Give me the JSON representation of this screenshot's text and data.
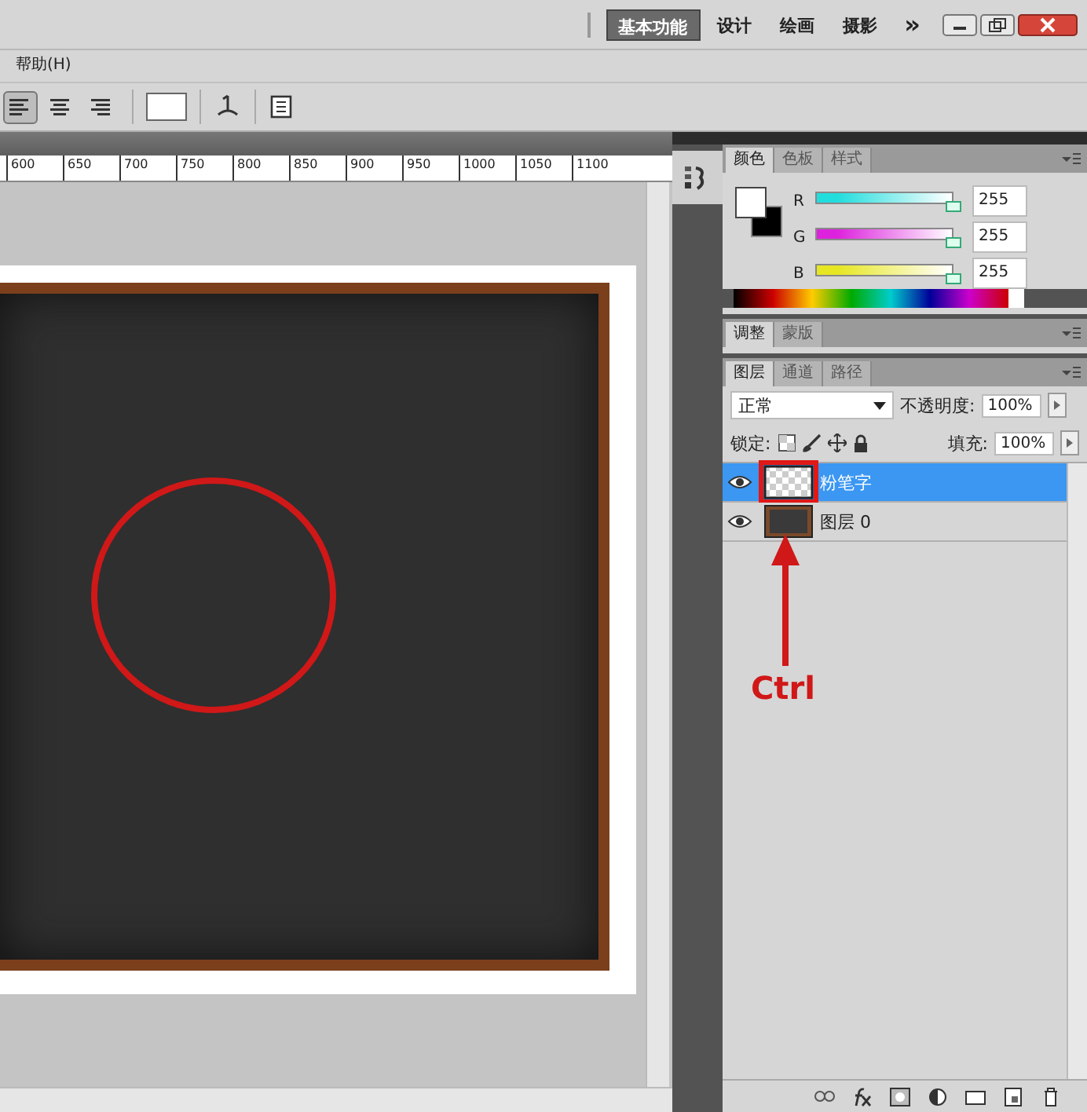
{
  "workspace_bar": {
    "buttons": [
      {
        "label": "基本功能",
        "selected": true
      },
      {
        "label": "设计",
        "selected": false
      },
      {
        "label": "绘画",
        "selected": false
      },
      {
        "label": "摄影",
        "selected": false
      }
    ],
    "more": "»"
  },
  "menu": [
    "帮助(H)"
  ],
  "options_bar": {
    "align": [
      {
        "selected": true
      },
      {
        "selected": false
      },
      {
        "selected": false
      }
    ]
  },
  "ruler": {
    "ticks": [
      "600",
      "650",
      "700",
      "750",
      "800",
      "850",
      "900",
      "950",
      "1000",
      "1050",
      "1100"
    ]
  },
  "color_panel": {
    "tabs": [
      {
        "label": "颜色",
        "selected": true
      },
      {
        "label": "色板",
        "selected": false
      },
      {
        "label": "样式",
        "selected": false
      }
    ],
    "channels": [
      {
        "name": "R",
        "color": "#22dddd",
        "level": 1,
        "value": "255"
      },
      {
        "name": "G",
        "color": "#dd22dd",
        "level": 1,
        "value": "255"
      },
      {
        "name": "B",
        "color": "#e6e622",
        "level": 1,
        "value": "255"
      }
    ]
  },
  "adjust_panel": {
    "tabs": [
      {
        "label": "调整",
        "selected": true
      },
      {
        "label": "蒙版",
        "selected": false
      }
    ]
  },
  "layers_panel": {
    "tabs": [
      {
        "label": "图层",
        "selected": true
      },
      {
        "label": "通道",
        "selected": false
      },
      {
        "label": "路径",
        "selected": false
      }
    ],
    "blend_mode": "正常",
    "opacity_label": "不透明度:",
    "opacity": "100%",
    "lock_label": "锁定:",
    "fill_label": "填充:",
    "fill": "100%",
    "layers": [
      {
        "name": "粉笔字",
        "selected": true,
        "visible": true,
        "kind": "transparent",
        "highlighted": true
      },
      {
        "name": "图层 0",
        "selected": false,
        "visible": true,
        "kind": "image",
        "highlighted": false
      }
    ]
  },
  "annotation": {
    "text": "Ctrl"
  }
}
